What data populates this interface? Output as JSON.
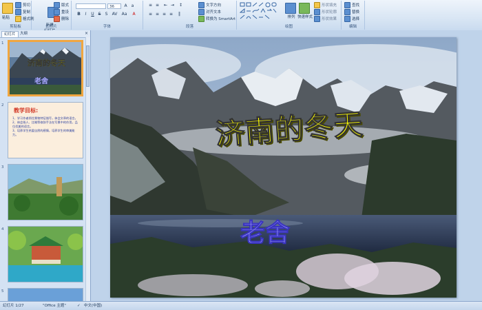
{
  "ribbon": {
    "clipboard": {
      "label": "剪贴板",
      "paste": "粘贴",
      "cut": "剪切",
      "copy": "复制",
      "format_painter": "格式刷"
    },
    "slides": {
      "label": "幻灯片",
      "new_slide": "新建\n幻灯片",
      "layout": "版式",
      "reset": "重设",
      "delete": "删除"
    },
    "font": {
      "label": "字体",
      "size": "36"
    },
    "paragraph": {
      "label": "段落",
      "text_direction": "文字方向",
      "align_text": "对齐文本",
      "smartart": "转换为 SmartArt"
    },
    "drawing": {
      "label": "绘图",
      "arrange": "排列",
      "quick_styles": "快速样式",
      "shape_fill": "形状填充",
      "shape_outline": "形状轮廓",
      "shape_effects": "形状效果"
    },
    "editing": {
      "label": "编辑",
      "find": "查找",
      "replace": "替换",
      "select": "选择"
    }
  },
  "panel": {
    "tab_slides": "幻灯片",
    "tab_outline": "大纲",
    "close": "×",
    "slide_numbers": [
      "1",
      "2",
      "3",
      "4",
      "5"
    ],
    "thumb1": {
      "title": "济南的冬天",
      "author": "老舍"
    },
    "thumb2": {
      "heading": "教学目标:",
      "items": [
        "1、学习作者抓住景物特征描写，体会文章的语言。",
        "2、体会拟人、比喻等修辞手法在写景中的作用，品位优美的语言。",
        "3、培养学生热爱自然的感情，培养学生的审美能力。"
      ]
    }
  },
  "slide": {
    "title": "济南的冬天",
    "author": "老舍"
  },
  "status": {
    "slide_count": "幻灯片 1/27",
    "theme": "\"Office 主题\"",
    "language": "中文(中国)"
  },
  "colors": {
    "title": "#ffff00",
    "author": "#a9a7ff",
    "selection": "#f0a640"
  }
}
